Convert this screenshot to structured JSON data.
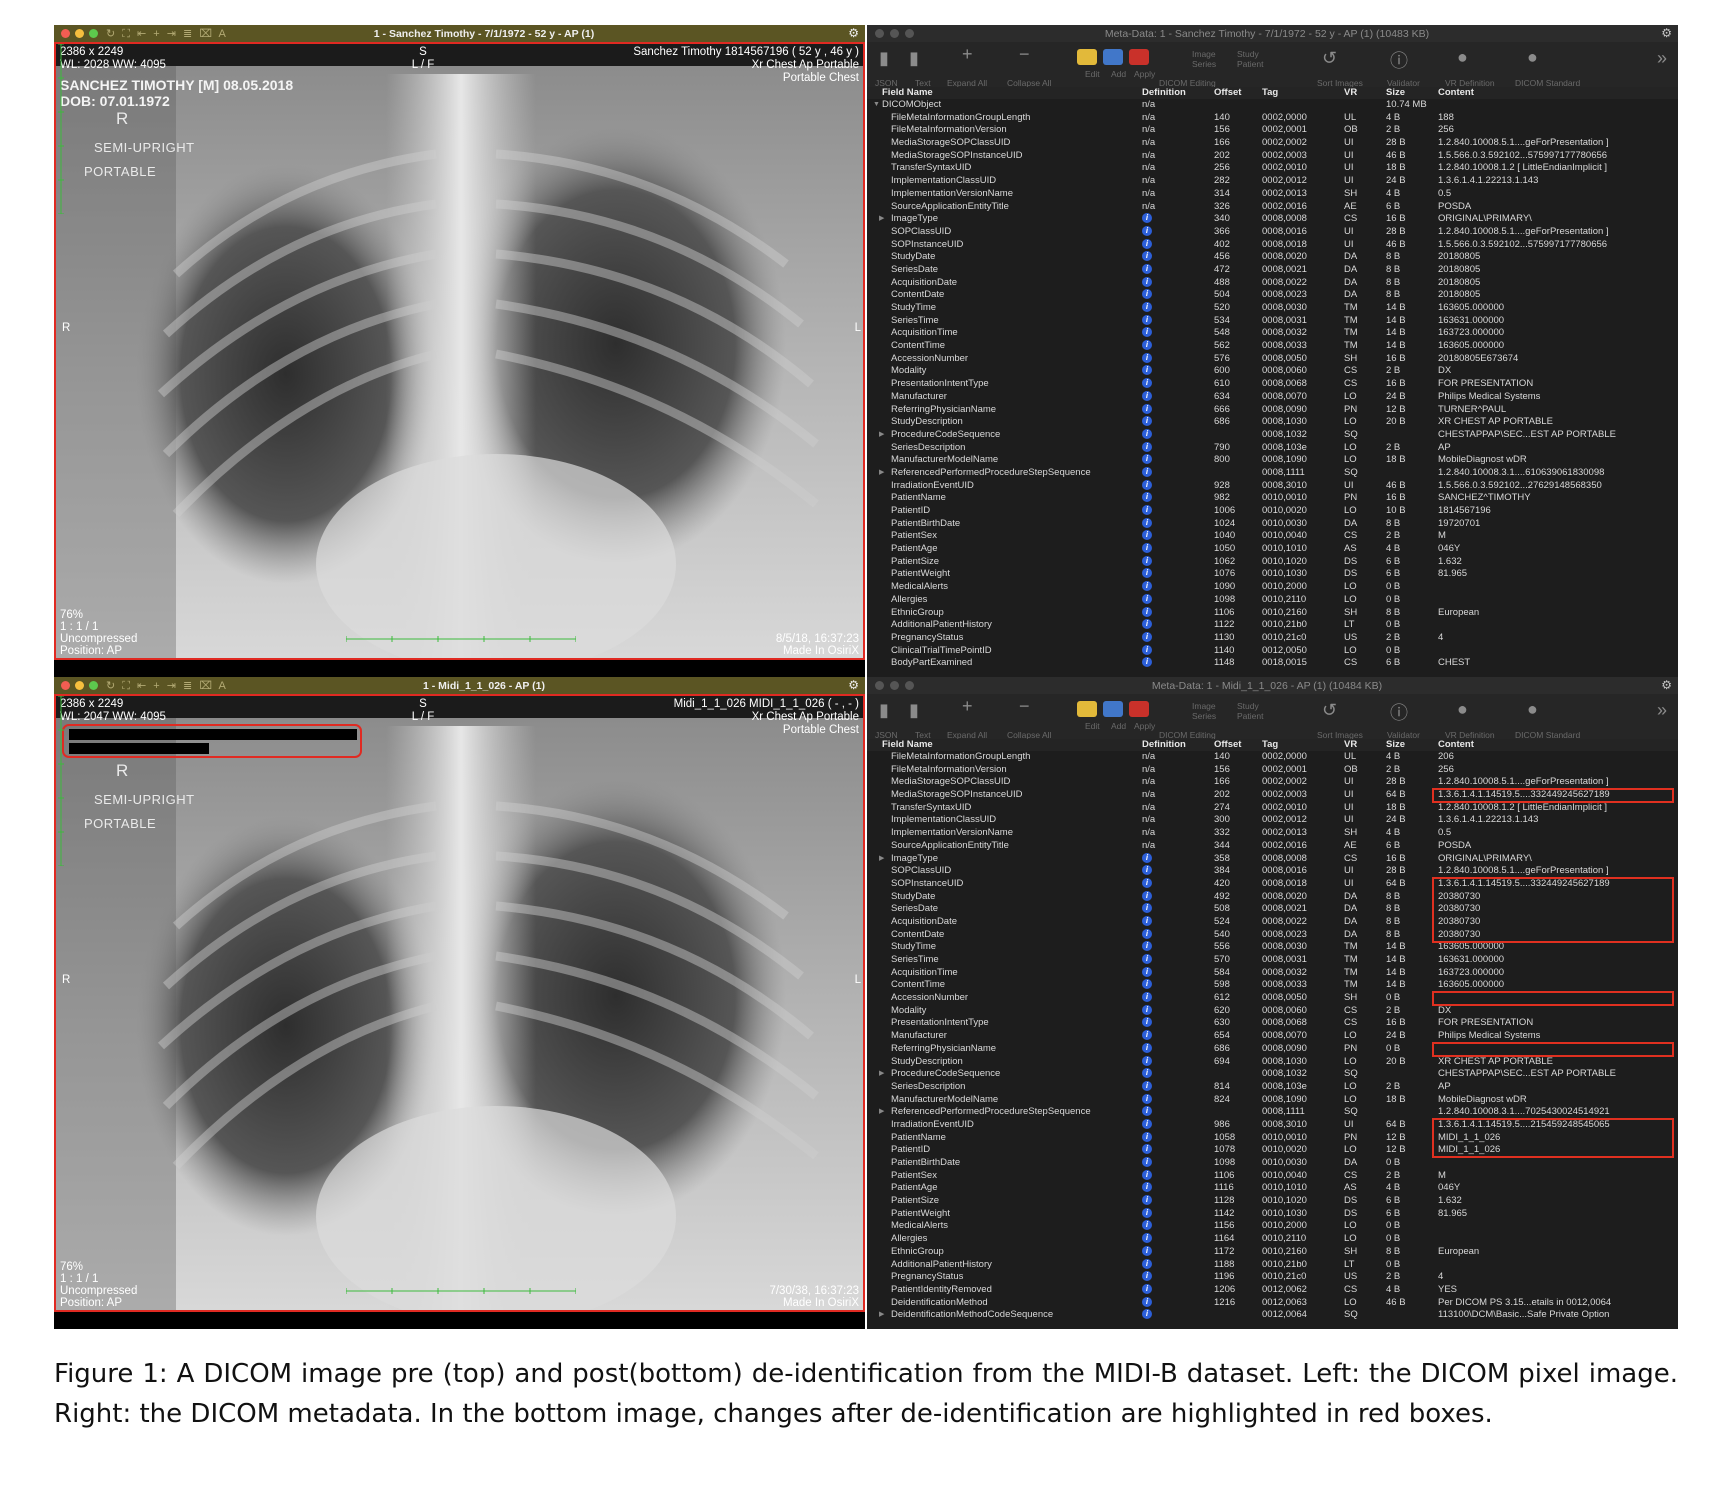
{
  "top": {
    "viewer": {
      "title": "1 - Sanchez Timothy - 7/1/1972 - 52 y - AP (1)",
      "tl1": "2386 x 2249",
      "tl2": "WL: 2028 WW: 4095",
      "tm1": "S",
      "tm2": "L / F",
      "tr1": "Sanchez Timothy 1814567196 ( 52 y , 46 y )",
      "tr2": "Xr Chest Ap Portable",
      "tr3": "Portable Chest",
      "burn1": "SANCHEZ TIMOTHY [M] 08.05.2018",
      "burn2": "DOB: 07.01.1972",
      "m_r": "R",
      "m_semi": "SEMI-UPRIGHT",
      "m_port": "PORTABLE",
      "side_l": "R",
      "side_r": "L",
      "bl1": "76%",
      "bl2": "1 : 1 / 1",
      "bl3": "Uncompressed",
      "bl4": "Position: AP",
      "br1": "8/5/18, 16:37:23",
      "br2": "Made In OsiriX"
    },
    "meta": {
      "title": "Meta-Data: 1 - Sanchez Timothy - 7/1/1972 - 52 y - AP (1) (10483 KB)",
      "rows": [
        [
          "",
          "DICOMObject",
          "n/a",
          "",
          "",
          "",
          "10.74 MB",
          ""
        ],
        [
          "FileMetaInformationGroupLength",
          "n/a",
          "140",
          "0002,0000",
          "UL",
          "4 B",
          "188"
        ],
        [
          "FileMetaInformationVersion",
          "n/a",
          "156",
          "0002,0001",
          "OB",
          "2 B",
          "256"
        ],
        [
          "MediaStorageSOPClassUID",
          "n/a",
          "166",
          "0002,0002",
          "UI",
          "28 B",
          "1.2.840.10008.5.1....geForPresentation ]"
        ],
        [
          "MediaStorageSOPInstanceUID",
          "n/a",
          "202",
          "0002,0003",
          "UI",
          "46 B",
          "1.5.566.0.3.592102...575997177780656"
        ],
        [
          "TransferSyntaxUID",
          "n/a",
          "256",
          "0002,0010",
          "UI",
          "18 B",
          "1.2.840.10008.1.2 [ LittleEndianImplicit ]"
        ],
        [
          "ImplementationClassUID",
          "n/a",
          "282",
          "0002,0012",
          "UI",
          "24 B",
          "1.3.6.1.4.1.22213.1.143"
        ],
        [
          "ImplementationVersionName",
          "n/a",
          "314",
          "0002,0013",
          "SH",
          "4 B",
          "0.5"
        ],
        [
          "SourceApplicationEntityTitle",
          "n/a",
          "326",
          "0002,0016",
          "AE",
          "6 B",
          "POSDA"
        ],
        [
          "ImageType",
          "i",
          "340",
          "0008,0008",
          "CS",
          "16 B",
          "ORIGINAL\\PRIMARY\\",
          "seq"
        ],
        [
          "SOPClassUID",
          "i",
          "366",
          "0008,0016",
          "UI",
          "28 B",
          "1.2.840.10008.5.1....geForPresentation ]"
        ],
        [
          "SOPInstanceUID",
          "i",
          "402",
          "0008,0018",
          "UI",
          "46 B",
          "1.5.566.0.3.592102...575997177780656"
        ],
        [
          "StudyDate",
          "i",
          "456",
          "0008,0020",
          "DA",
          "8 B",
          "20180805"
        ],
        [
          "SeriesDate",
          "i",
          "472",
          "0008,0021",
          "DA",
          "8 B",
          "20180805"
        ],
        [
          "AcquisitionDate",
          "i",
          "488",
          "0008,0022",
          "DA",
          "8 B",
          "20180805"
        ],
        [
          "ContentDate",
          "i",
          "504",
          "0008,0023",
          "DA",
          "8 B",
          "20180805"
        ],
        [
          "StudyTime",
          "i",
          "520",
          "0008,0030",
          "TM",
          "14 B",
          "163605.000000"
        ],
        [
          "SeriesTime",
          "i",
          "534",
          "0008,0031",
          "TM",
          "14 B",
          "163631.000000"
        ],
        [
          "AcquisitionTime",
          "i",
          "548",
          "0008,0032",
          "TM",
          "14 B",
          "163723.000000"
        ],
        [
          "ContentTime",
          "i",
          "562",
          "0008,0033",
          "TM",
          "14 B",
          "163605.000000"
        ],
        [
          "AccessionNumber",
          "i",
          "576",
          "0008,0050",
          "SH",
          "16 B",
          "20180805E673674"
        ],
        [
          "Modality",
          "i",
          "600",
          "0008,0060",
          "CS",
          "2 B",
          "DX"
        ],
        [
          "PresentationIntentType",
          "i",
          "610",
          "0008,0068",
          "CS",
          "16 B",
          "FOR PRESENTATION"
        ],
        [
          "Manufacturer",
          "i",
          "634",
          "0008,0070",
          "LO",
          "24 B",
          "Philips Medical Systems"
        ],
        [
          "ReferringPhysicianName",
          "i",
          "666",
          "0008,0090",
          "PN",
          "12 B",
          "TURNER^PAUL"
        ],
        [
          "StudyDescription",
          "i",
          "686",
          "0008,1030",
          "LO",
          "20 B",
          "XR CHEST AP PORTABLE"
        ],
        [
          "ProcedureCodeSequence",
          "i",
          "",
          "0008,1032",
          "SQ",
          "",
          "CHESTAPPAP\\SEC...EST AP PORTABLE",
          "seq"
        ],
        [
          "SeriesDescription",
          "i",
          "790",
          "0008,103e",
          "LO",
          "2 B",
          "AP"
        ],
        [
          "ManufacturerModelName",
          "i",
          "800",
          "0008,1090",
          "LO",
          "18 B",
          "MobileDiagnost wDR"
        ],
        [
          "ReferencedPerformedProcedureStepSequence",
          "i",
          "",
          "0008,1111",
          "SQ",
          "",
          "1.2.840.10008.3.1....610639061830098",
          "seq"
        ],
        [
          "IrradiationEventUID",
          "i",
          "928",
          "0008,3010",
          "UI",
          "46 B",
          "1.5.566.0.3.592102...27629148568350"
        ],
        [
          "PatientName",
          "i",
          "982",
          "0010,0010",
          "PN",
          "16 B",
          "SANCHEZ^TIMOTHY"
        ],
        [
          "PatientID",
          "i",
          "1006",
          "0010,0020",
          "LO",
          "10 B",
          "1814567196"
        ],
        [
          "PatientBirthDate",
          "i",
          "1024",
          "0010,0030",
          "DA",
          "8 B",
          "19720701"
        ],
        [
          "PatientSex",
          "i",
          "1040",
          "0010,0040",
          "CS",
          "2 B",
          "M"
        ],
        [
          "PatientAge",
          "i",
          "1050",
          "0010,1010",
          "AS",
          "4 B",
          "046Y"
        ],
        [
          "PatientSize",
          "i",
          "1062",
          "0010,1020",
          "DS",
          "6 B",
          "1.632"
        ],
        [
          "PatientWeight",
          "i",
          "1076",
          "0010,1030",
          "DS",
          "6 B",
          "81.965"
        ],
        [
          "MedicalAlerts",
          "i",
          "1090",
          "0010,2000",
          "LO",
          "0 B",
          ""
        ],
        [
          "Allergies",
          "i",
          "1098",
          "0010,2110",
          "LO",
          "0 B",
          ""
        ],
        [
          "EthnicGroup",
          "i",
          "1106",
          "0010,2160",
          "SH",
          "8 B",
          "European"
        ],
        [
          "AdditionalPatientHistory",
          "i",
          "1122",
          "0010,21b0",
          "LT",
          "0 B",
          ""
        ],
        [
          "PregnancyStatus",
          "i",
          "1130",
          "0010,21c0",
          "US",
          "2 B",
          "4"
        ],
        [
          "ClinicalTrialTimePointID",
          "i",
          "1140",
          "0012,0050",
          "LO",
          "0 B",
          ""
        ],
        [
          "BodyPartExamined",
          "i",
          "1148",
          "0018,0015",
          "CS",
          "6 B",
          "CHEST"
        ]
      ]
    }
  },
  "bottom": {
    "viewer": {
      "title": "1 - Midi_1_1_026 - AP (1)",
      "tl1": "2386 x 2249",
      "tl2": "WL: 2047 WW: 4095",
      "tm1": "S",
      "tm2": "L / F",
      "tr1": "Midi_1_1_026 MIDI_1_1_026 ( - , - )",
      "tr2": "Xr Chest Ap Portable",
      "tr3": "Portable Chest",
      "m_r": "R",
      "m_semi": "SEMI-UPRIGHT",
      "m_port": "PORTABLE",
      "side_l": "R",
      "side_r": "L",
      "bl1": "76%",
      "bl2": "1 : 1 / 1",
      "bl3": "Uncompressed",
      "bl4": "Position: AP",
      "br1": "7/30/38, 16:37:23",
      "br2": "Made In OsiriX"
    },
    "meta": {
      "title": "Meta-Data: 1 - Midi_1_1_026 - AP (1) (10484 KB)",
      "rows": [
        [
          "FileMetaInformationGroupLength",
          "n/a",
          "140",
          "0002,0000",
          "UL",
          "4 B",
          "206"
        ],
        [
          "FileMetaInformationVersion",
          "n/a",
          "156",
          "0002,0001",
          "OB",
          "2 B",
          "256"
        ],
        [
          "MediaStorageSOPClassUID",
          "n/a",
          "166",
          "0002,0002",
          "UI",
          "28 B",
          "1.2.840.10008.5.1....geForPresentation ]"
        ],
        [
          "MediaStorageSOPInstanceUID",
          "n/a",
          "202",
          "0002,0003",
          "UI",
          "64 B",
          "1.3.6.1.4.1.14519.5....332449245627189"
        ],
        [
          "TransferSyntaxUID",
          "n/a",
          "274",
          "0002,0010",
          "UI",
          "18 B",
          "1.2.840.10008.1.2 [ LittleEndianImplicit ]"
        ],
        [
          "ImplementationClassUID",
          "n/a",
          "300",
          "0002,0012",
          "UI",
          "24 B",
          "1.3.6.1.4.1.22213.1.143"
        ],
        [
          "ImplementationVersionName",
          "n/a",
          "332",
          "0002,0013",
          "SH",
          "4 B",
          "0.5"
        ],
        [
          "SourceApplicationEntityTitle",
          "n/a",
          "344",
          "0002,0016",
          "AE",
          "6 B",
          "POSDA"
        ],
        [
          "ImageType",
          "i",
          "358",
          "0008,0008",
          "CS",
          "16 B",
          "ORIGINAL\\PRIMARY\\",
          "seq"
        ],
        [
          "SOPClassUID",
          "i",
          "384",
          "0008,0016",
          "UI",
          "28 B",
          "1.2.840.10008.5.1....geForPresentation ]"
        ],
        [
          "SOPInstanceUID",
          "i",
          "420",
          "0008,0018",
          "UI",
          "64 B",
          "1.3.6.1.4.1.14519.5....332449245627189"
        ],
        [
          "StudyDate",
          "i",
          "492",
          "0008,0020",
          "DA",
          "8 B",
          "20380730"
        ],
        [
          "SeriesDate",
          "i",
          "508",
          "0008,0021",
          "DA",
          "8 B",
          "20380730"
        ],
        [
          "AcquisitionDate",
          "i",
          "524",
          "0008,0022",
          "DA",
          "8 B",
          "20380730"
        ],
        [
          "ContentDate",
          "i",
          "540",
          "0008,0023",
          "DA",
          "8 B",
          "20380730"
        ],
        [
          "StudyTime",
          "i",
          "556",
          "0008,0030",
          "TM",
          "14 B",
          "163605.000000"
        ],
        [
          "SeriesTime",
          "i",
          "570",
          "0008,0031",
          "TM",
          "14 B",
          "163631.000000"
        ],
        [
          "AcquisitionTime",
          "i",
          "584",
          "0008,0032",
          "TM",
          "14 B",
          "163723.000000"
        ],
        [
          "ContentTime",
          "i",
          "598",
          "0008,0033",
          "TM",
          "14 B",
          "163605.000000"
        ],
        [
          "AccessionNumber",
          "i",
          "612",
          "0008,0050",
          "SH",
          "0 B",
          ""
        ],
        [
          "Modality",
          "i",
          "620",
          "0008,0060",
          "CS",
          "2 B",
          "DX"
        ],
        [
          "PresentationIntentType",
          "i",
          "630",
          "0008,0068",
          "CS",
          "16 B",
          "FOR PRESENTATION"
        ],
        [
          "Manufacturer",
          "i",
          "654",
          "0008,0070",
          "LO",
          "24 B",
          "Philips Medical Systems"
        ],
        [
          "ReferringPhysicianName",
          "i",
          "686",
          "0008,0090",
          "PN",
          "0 B",
          ""
        ],
        [
          "StudyDescription",
          "i",
          "694",
          "0008,1030",
          "LO",
          "20 B",
          "XR CHEST AP PORTABLE"
        ],
        [
          "ProcedureCodeSequence",
          "i",
          "",
          "0008,1032",
          "SQ",
          "",
          "CHESTAPPAP\\SEC...EST AP PORTABLE",
          "seq"
        ],
        [
          "SeriesDescription",
          "i",
          "814",
          "0008,103e",
          "LO",
          "2 B",
          "AP"
        ],
        [
          "ManufacturerModelName",
          "i",
          "824",
          "0008,1090",
          "LO",
          "18 B",
          "MobileDiagnost wDR"
        ],
        [
          "ReferencedPerformedProcedureStepSequence",
          "i",
          "",
          "0008,1111",
          "SQ",
          "",
          "1.2.840.10008.3.1....7025430024514921",
          "seq"
        ],
        [
          "IrradiationEventUID",
          "i",
          "986",
          "0008,3010",
          "UI",
          "64 B",
          "1.3.6.1.4.1.14519.5....215459248545065"
        ],
        [
          "PatientName",
          "i",
          "1058",
          "0010,0010",
          "PN",
          "12 B",
          "MIDI_1_1_026"
        ],
        [
          "PatientID",
          "i",
          "1078",
          "0010,0020",
          "LO",
          "12 B",
          "MIDI_1_1_026"
        ],
        [
          "PatientBirthDate",
          "i",
          "1098",
          "0010,0030",
          "DA",
          "0 B",
          ""
        ],
        [
          "PatientSex",
          "i",
          "1106",
          "0010,0040",
          "CS",
          "2 B",
          "M"
        ],
        [
          "PatientAge",
          "i",
          "1116",
          "0010,1010",
          "AS",
          "4 B",
          "046Y"
        ],
        [
          "PatientSize",
          "i",
          "1128",
          "0010,1020",
          "DS",
          "6 B",
          "1.632"
        ],
        [
          "PatientWeight",
          "i",
          "1142",
          "0010,1030",
          "DS",
          "6 B",
          "81.965"
        ],
        [
          "MedicalAlerts",
          "i",
          "1156",
          "0010,2000",
          "LO",
          "0 B",
          ""
        ],
        [
          "Allergies",
          "i",
          "1164",
          "0010,2110",
          "LO",
          "0 B",
          ""
        ],
        [
          "EthnicGroup",
          "i",
          "1172",
          "0010,2160",
          "SH",
          "8 B",
          "European"
        ],
        [
          "AdditionalPatientHistory",
          "i",
          "1188",
          "0010,21b0",
          "LT",
          "0 B",
          ""
        ],
        [
          "PregnancyStatus",
          "i",
          "1196",
          "0010,21c0",
          "US",
          "2 B",
          "4"
        ],
        [
          "PatientIdentityRemoved",
          "i",
          "1206",
          "0012,0062",
          "CS",
          "4 B",
          "YES"
        ],
        [
          "DeidentificationMethod",
          "i",
          "1216",
          "0012,0063",
          "LO",
          "46 B",
          "Per DICOM PS 3.15...etails in 0012,0064"
        ],
        [
          "DeidentificationMethodCodeSequence",
          "i",
          "",
          "0012,0064",
          "SQ",
          "",
          "113100\\DCM\\Basic...Safe Private Option",
          "seq"
        ]
      ]
    }
  },
  "meta_ui": {
    "headers": [
      "Field Name",
      "Definition",
      "Offset",
      "Tag",
      "VR",
      "Size",
      "Content"
    ],
    "toolbar": {
      "json": "JSON",
      "text": "Text",
      "expand": "Expand All",
      "collapse": "Collapse All",
      "edit": "Edit",
      "add": "Add",
      "apply": "Apply",
      "dicom_editing": "DICOM Editing",
      "image": "Image",
      "study": "Study",
      "series": "Series",
      "patient": "Patient",
      "sort": "Sort Images",
      "validator": "Validator",
      "vrdef": "VR Definition",
      "standard": "DICOM Standard"
    }
  },
  "caption": "Figure 1: A DICOM image pre (top) and post(bottom) de-identification from the MIDI-B dataset. Left: the DICOM pixel image. Right: the DICOM metadata. In the bottom image, changes after de-identification are highlighted in red boxes."
}
